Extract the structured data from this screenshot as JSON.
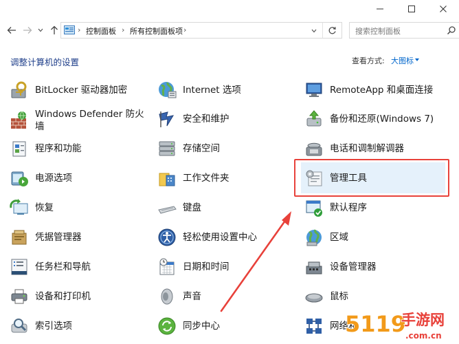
{
  "window": {
    "controls": [
      "minimize-icon",
      "maximize-icon",
      "close-icon"
    ]
  },
  "address": {
    "breadcrumb": [
      "控制面板",
      "所有控制面板项"
    ],
    "search_placeholder": "搜索控制面板"
  },
  "page": {
    "heading": "调整计算机的设置",
    "view_by_label": "查看方式:",
    "view_by_value": "大图标"
  },
  "items": [
    {
      "label": "BitLocker 驱动器加密",
      "icon": "bitlocker-icon"
    },
    {
      "label": "Internet 选项",
      "icon": "internet-options-icon"
    },
    {
      "label": "RemoteApp 和桌面连接",
      "icon": "remoteapp-icon"
    },
    {
      "label": "Windows Defender 防火墙",
      "icon": "firewall-icon"
    },
    {
      "label": "安全和维护",
      "icon": "security-maintenance-icon"
    },
    {
      "label": "备份和还原(Windows 7)",
      "icon": "backup-icon"
    },
    {
      "label": "程序和功能",
      "icon": "programs-icon"
    },
    {
      "label": "存储空间",
      "icon": "storage-icon"
    },
    {
      "label": "电话和调制解调器",
      "icon": "phone-modem-icon"
    },
    {
      "label": "电源选项",
      "icon": "power-icon"
    },
    {
      "label": "工作文件夹",
      "icon": "work-folders-icon"
    },
    {
      "label": "管理工具",
      "icon": "admin-tools-icon"
    },
    {
      "label": "恢复",
      "icon": "recovery-icon"
    },
    {
      "label": "键盘",
      "icon": "keyboard-icon"
    },
    {
      "label": "默认程序",
      "icon": "default-programs-icon"
    },
    {
      "label": "凭据管理器",
      "icon": "credential-icon"
    },
    {
      "label": "轻松使用设置中心",
      "icon": "ease-of-access-icon"
    },
    {
      "label": "区域",
      "icon": "region-icon"
    },
    {
      "label": "任务栏和导航",
      "icon": "taskbar-icon"
    },
    {
      "label": "日期和时间",
      "icon": "datetime-icon"
    },
    {
      "label": "设备管理器",
      "icon": "device-manager-icon"
    },
    {
      "label": "设备和打印机",
      "icon": "printer-icon"
    },
    {
      "label": "声音",
      "icon": "sound-icon"
    },
    {
      "label": "鼠标",
      "icon": "mouse-icon"
    },
    {
      "label": "索引选项",
      "icon": "indexing-icon"
    },
    {
      "label": "同步中心",
      "icon": "sync-icon"
    },
    {
      "label": "网络和",
      "icon": "network-icon"
    }
  ],
  "colors": {
    "heading": "#1e3e8a",
    "link": "#0066cc",
    "highlight": "#e5f1fb",
    "annotation": "#e8413a"
  },
  "watermark": {
    "text_main": "手游网",
    "text_num": "5119",
    "text_url": ".com.cn"
  }
}
